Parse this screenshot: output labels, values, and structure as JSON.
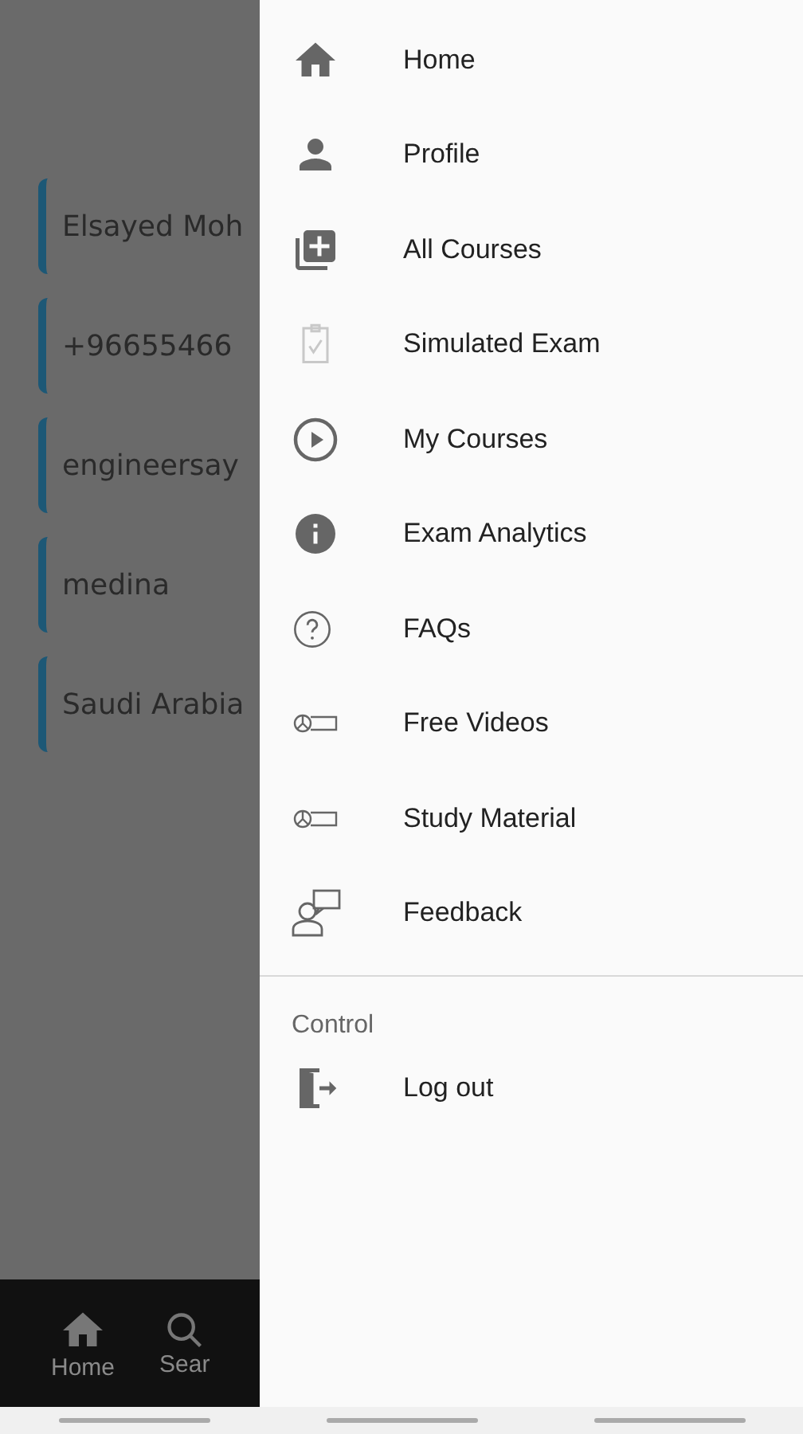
{
  "form": {
    "fields": [
      {
        "value": "Elsayed Moh"
      },
      {
        "value": "+96655466"
      },
      {
        "value": "engineersay"
      },
      {
        "value": "medina"
      },
      {
        "value": "Saudi Arabia"
      }
    ]
  },
  "bottom_nav": [
    {
      "label": "Home"
    },
    {
      "label": "Sear"
    }
  ],
  "drawer": {
    "items": [
      {
        "label": "Home"
      },
      {
        "label": "Profile"
      },
      {
        "label": "All Courses"
      },
      {
        "label": "Simulated Exam"
      },
      {
        "label": "My Courses"
      },
      {
        "label": "Exam Analytics"
      },
      {
        "label": "FAQs"
      },
      {
        "label": "Free Videos"
      },
      {
        "label": "Study Material"
      },
      {
        "label": "Feedback"
      }
    ],
    "section_title": "Control",
    "control_items": [
      {
        "label": "Log out"
      }
    ]
  }
}
